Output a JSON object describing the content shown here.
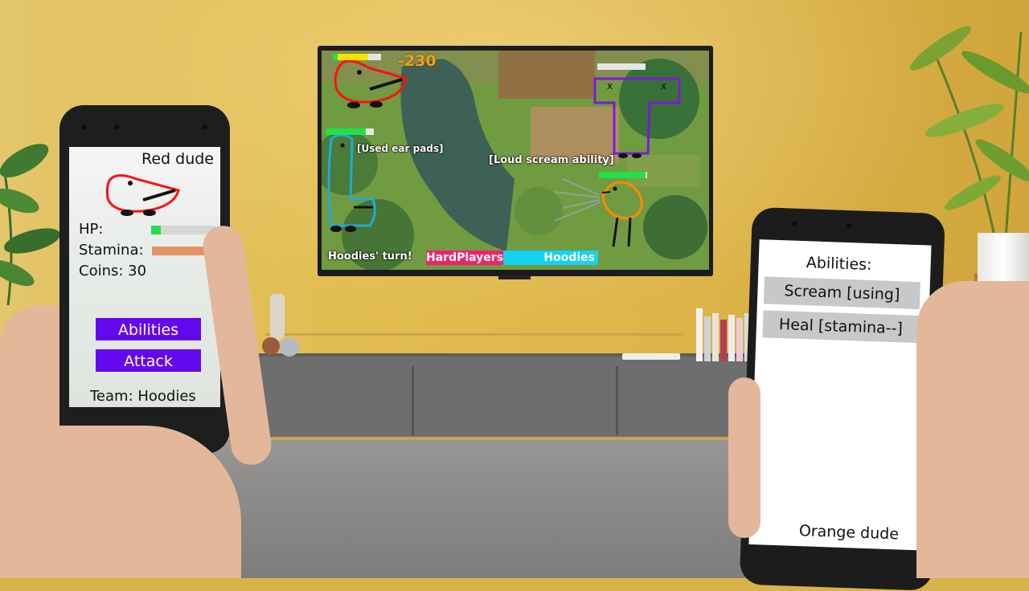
{
  "tv": {
    "damage_popup": "-230",
    "status_used_ear_pads": "[Used ear pads]",
    "status_loud_scream": "[Loud scream ability]",
    "turn_text": "Hoodies' turn!",
    "team_labels": [
      "HardPlayers",
      "Hoodies"
    ],
    "colors": {
      "team_hardplayers": "#f0226a",
      "team_hoodies": "#13d3f0",
      "hp_full": "#22e04a",
      "hp_low": "#f5e600"
    }
  },
  "phone_left": {
    "character_name": "Red dude",
    "hp_label": "HP:",
    "hp_fraction": 0.15,
    "stamina_label": "Stamina:",
    "stamina_fraction": 1.0,
    "coins_label": "Coins: 30",
    "abilities_button": "Abilities",
    "attack_button": "Attack",
    "team_label": "Team: Hoodies",
    "colors": {
      "button": "#6408ee",
      "hp_fill": "#22e04a",
      "stamina_fill": "#e59366"
    }
  },
  "phone_right": {
    "title": "Abilities:",
    "abilities": [
      "Scream [using]",
      "Heal [stamina--]"
    ],
    "character_name": "Orange dude"
  }
}
